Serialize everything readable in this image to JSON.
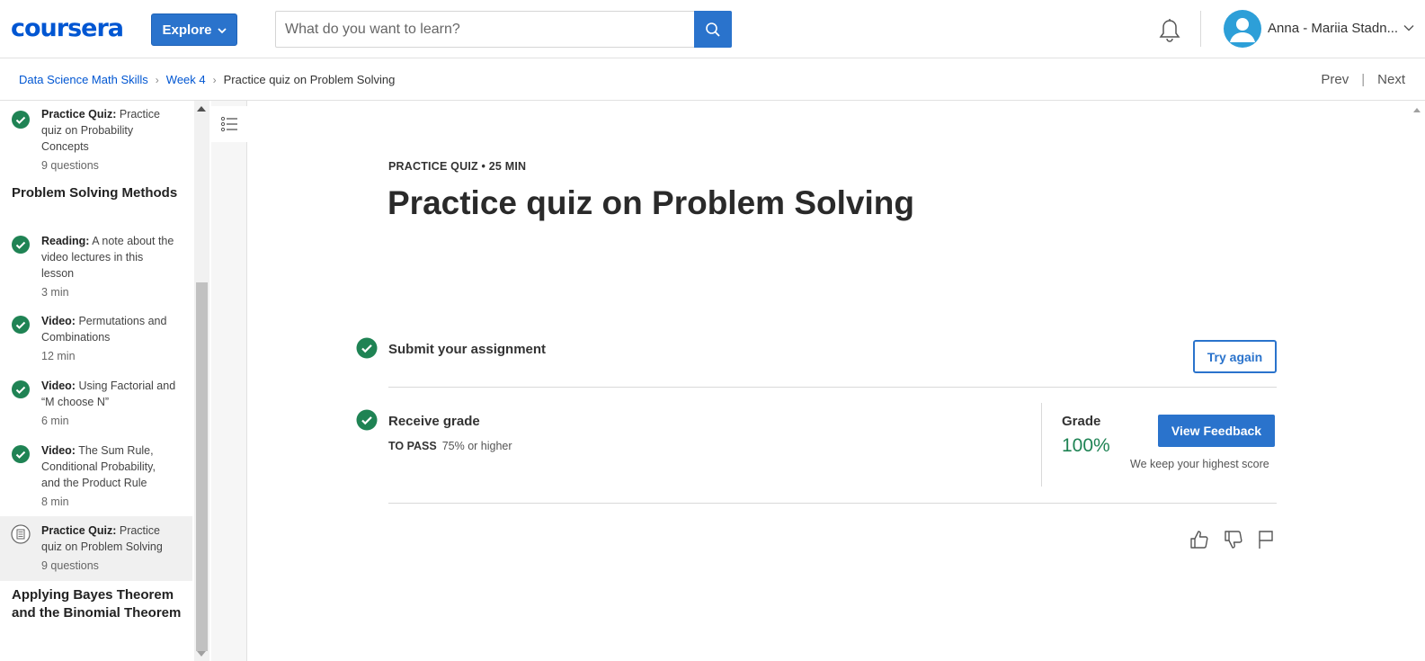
{
  "header": {
    "logo": "coursera",
    "explore_label": "Explore",
    "search_placeholder": "What do you want to learn?",
    "user_name": "Anna - Mariia Stadn...",
    "colors": {
      "brand": "#0056d2",
      "button": "#2a73cc",
      "avatar": "#2d9fd8"
    }
  },
  "breadcrumb": {
    "items": [
      "Data Science Math Skills",
      "Week 4",
      "Practice quiz on Problem Solving"
    ],
    "prev": "Prev",
    "next": "Next"
  },
  "sidebar": {
    "items": [
      {
        "type": "Practice Quiz:",
        "title": "Practice quiz on Probability Concepts",
        "meta": "9 questions",
        "status": "completed"
      },
      {
        "type": "Reading:",
        "title": "A note about the video lectures in this lesson",
        "meta": "3 min",
        "status": "completed"
      },
      {
        "type": "Video:",
        "title": "Permutations and Combinations",
        "meta": "12 min",
        "status": "completed"
      },
      {
        "type": "Video:",
        "title": "Using Factorial and “M choose N”",
        "meta": "6 min",
        "status": "completed"
      },
      {
        "type": "Video:",
        "title": "The Sum Rule, Conditional Probability, and the Product Rule",
        "meta": "8 min",
        "status": "completed"
      },
      {
        "type": "Practice Quiz:",
        "title": "Practice quiz on Problem Solving",
        "meta": "9 questions",
        "status": "current"
      }
    ],
    "sections": [
      "Problem Solving Methods",
      "Applying Bayes Theorem and the Binomial Theorem"
    ]
  },
  "main": {
    "eyebrow": "PRACTICE QUIZ • 25 MIN",
    "title": "Practice quiz on Problem Solving",
    "submit_label": "Submit your assignment",
    "try_again": "Try again",
    "receive_label": "Receive grade",
    "to_pass_label": "TO PASS",
    "to_pass_value": "75% or higher",
    "grade_label": "Grade",
    "grade_value": "100%",
    "view_feedback": "View Feedback",
    "keep_score": "We keep your highest score",
    "colors": {
      "success": "#1f8354"
    }
  }
}
